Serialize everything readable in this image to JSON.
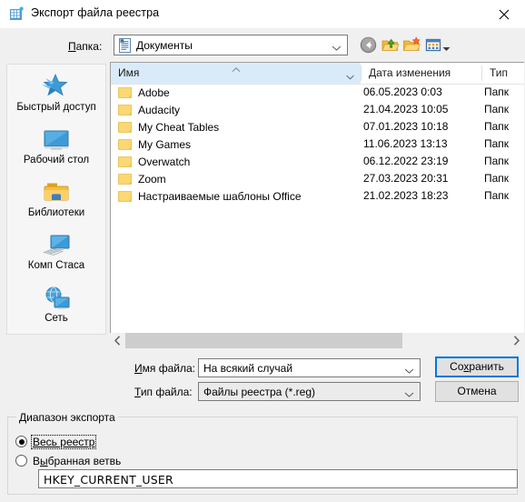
{
  "window": {
    "title": "Экспорт файла реестра",
    "icon": "registry-editor-icon",
    "close_label": "✕"
  },
  "toolbar": {
    "folder_label_prefix": "",
    "folder_label": "Папка:",
    "folder_label_accel": "П",
    "folder_label_rest": "апка:",
    "current_folder": "Документы",
    "buttons": [
      {
        "name": "back-button",
        "tooltip": "Назад"
      },
      {
        "name": "up-one-level-button",
        "tooltip": "Переход на один уровень вверх"
      },
      {
        "name": "new-folder-button",
        "tooltip": "Создание новой папки"
      },
      {
        "name": "view-menu-button",
        "tooltip": "Изменить представление"
      }
    ]
  },
  "places": [
    {
      "label": "Быстрый доступ",
      "icon": "quick-access-star-icon"
    },
    {
      "label": "Рабочий стол",
      "icon": "desktop-monitor-icon"
    },
    {
      "label": "Библиотеки",
      "icon": "libraries-folder-icon"
    },
    {
      "label": "Комп Стаса",
      "icon": "this-pc-icon"
    },
    {
      "label": "Сеть",
      "icon": "network-globe-icon"
    }
  ],
  "filelist": {
    "columns": [
      {
        "label": "Имя",
        "sorted": true,
        "sort_direction": "ascending"
      },
      {
        "label": "Дата изменения",
        "sorted": false
      },
      {
        "label": "Тип",
        "sorted": false
      }
    ],
    "rows": [
      {
        "name": "Adobe",
        "date": "06.05.2023 0:03",
        "type": "Папк"
      },
      {
        "name": "Audacity",
        "date": "21.04.2023 10:05",
        "type": "Папк"
      },
      {
        "name": "My Cheat Tables",
        "date": "07.01.2023 10:18",
        "type": "Папк"
      },
      {
        "name": "My Games",
        "date": "11.06.2023 13:13",
        "type": "Папк"
      },
      {
        "name": "Overwatch",
        "date": "06.12.2022 23:19",
        "type": "Папк"
      },
      {
        "name": "Zoom",
        "date": "27.03.2023 20:31",
        "type": "Папк"
      },
      {
        "name": "Настраиваемые шаблоны Office",
        "date": "21.02.2023 18:23",
        "type": "Папк"
      }
    ]
  },
  "form": {
    "filename_label_accel": "И",
    "filename_label_rest": "мя файла:",
    "filename_value": "На всякий случай",
    "filetype_label_accel": "Т",
    "filetype_label_rest": "ип файла:",
    "filetype_value": "Файлы реестра (*.reg)",
    "save_accel": "х",
    "save_before": "Со",
    "save_after": "ранить",
    "cancel_label": "Отмена"
  },
  "export_range": {
    "group_accel": "Д",
    "group_rest": "иапазон экспорта",
    "option_all": "Весь реестр",
    "option_all_selected": true,
    "option_all_focused": true,
    "option_branch_accel_before": "В",
    "option_branch_accel": "ы",
    "option_branch_after": "бранная ветвь",
    "option_branch_selected": false,
    "branch_value": "HKEY_CURRENT_USER"
  },
  "colors": {
    "dialog_bg": "#f0f0f0",
    "titlebar_bg": "#ffffff",
    "places_bg": "#f6f6f6",
    "list_bg": "#ffffff",
    "sorted_header_bg": "#d9ebf9",
    "default_button_border": "#0078d7",
    "scrollbar_thumb": "#cdcdcd",
    "folder_icon": "#fbd872"
  }
}
